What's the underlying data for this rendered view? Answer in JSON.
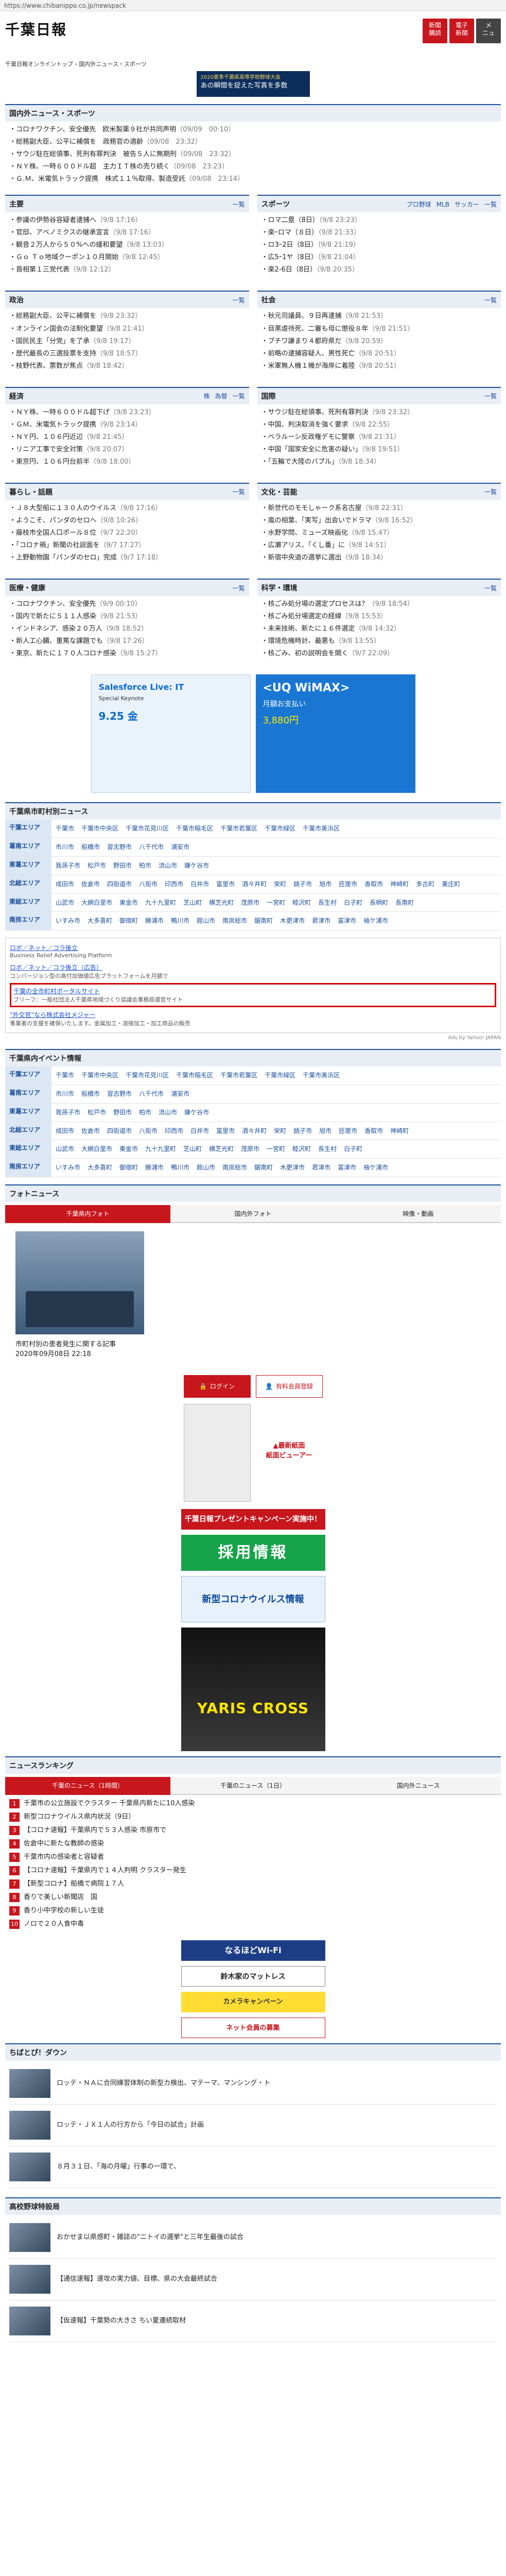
{
  "browser": {
    "url": "https://www.chibanippo.co.jp/newspack"
  },
  "header": {
    "logo": "千葉日報",
    "buttons": [
      "新聞\n購読",
      "電子\n新聞",
      "メ\nニュ"
    ],
    "breadcrumb": "千葉日報オンライントップ › 国内外ニュース・スポーツ"
  },
  "banner": {
    "line1": "2020夏季千葉県高等学校野球大会",
    "line2": "あの瞬間を捉えた写真を多数"
  },
  "domestic": {
    "title": "国内外ニュース・スポーツ",
    "items": [
      {
        "text": "・コロナワクチン、安全優先　欧米製薬９社が共同声明",
        "date": "（09/09　00:10）"
      },
      {
        "text": "・総務副大臣、公平に補償を　政務官の適齢",
        "date": "（09/08　23:32）"
      },
      {
        "text": "・サウジ駐在総領事、死刑有罪判決　被告５人に無期刑",
        "date": "（09/08　23:32）"
      },
      {
        "text": "・ＮＹ株、一時６００ドル超　主力ＩＴ株の売り続く",
        "date": "（09/08　23:23）"
      },
      {
        "text": "・Ｇ.Ｍ、米電気トラック提携　株式１１％取得、製造受託",
        "date": "（09/08　23:14）"
      }
    ]
  },
  "categories": [
    {
      "left": {
        "title": "主要",
        "more": "一覧",
        "items": [
          {
            "text": "・参議の伊勢谷容疑者逮捕へ",
            "date": "（9/8 17:16）"
          },
          {
            "text": "・官邸、アベノミクスの継承宣言",
            "date": "（9/8 17:16）"
          },
          {
            "text": "・観音２万人から５０%への緩和要望",
            "date": "（9/8 13:03）"
          },
          {
            "text": "・Ｇｏ Ｔｏ地域クーポン１０月開始",
            "date": "（9/8 12:45）"
          },
          {
            "text": "・首相第１三党代表",
            "date": "（9/8 12:12）"
          }
        ]
      },
      "right": {
        "title": "スポーツ",
        "tabs": [
          "プロ野球",
          "MLB",
          "サッカー"
        ],
        "more": "一覧",
        "items": [
          {
            "text": "・ロマ二塁（8日）",
            "date": "（9/8 23:23）"
          },
          {
            "text": "・楽ｰロマ（８日）",
            "date": "（9/8 21:33）"
          },
          {
            "text": "・ロ3ｰ2日（8日）",
            "date": "（9/8 21:19）"
          },
          {
            "text": "・広5ｰ1ヤ（8日）",
            "date": "（9/8 21:04）"
          },
          {
            "text": "・楽2-6日（8日）",
            "date": "（9/8 20:35）"
          }
        ]
      }
    },
    {
      "left": {
        "title": "政治",
        "more": "一覧",
        "items": [
          {
            "text": "・総務副大臣、公平に補償を",
            "date": "（9/8 23:32）"
          },
          {
            "text": "・オンライン国会の法制化要望",
            "date": "（9/8 21:41）"
          },
          {
            "text": "・国民民主「分党」を了承",
            "date": "（9/8 19:17）"
          },
          {
            "text": "・歴代最長の三選投票を支持",
            "date": "（9/8 18:57）"
          },
          {
            "text": "・枝野代表、票数が焦点",
            "date": "（9/8 18:42）"
          }
        ]
      },
      "right": {
        "title": "社会",
        "more": "一覧",
        "items": [
          {
            "text": "・秋元司議員、９日再逮捕",
            "date": "（9/8 21:53）"
          },
          {
            "text": "・目黒虐待死、二審も母に懲役８年",
            "date": "（9/8 21:51）"
          },
          {
            "text": "・ブチワ謙まり４都府県だ",
            "date": "（9/8 20:59）"
          },
          {
            "text": "・前略の逮捕容疑人、男性死亡",
            "date": "（9/8 20:51）"
          },
          {
            "text": "・米軍無人機１機が海岸に着陸",
            "date": "（9/8 20:51）"
          }
        ]
      }
    },
    {
      "left": {
        "title": "経済",
        "tabs": [
          "株",
          "為替"
        ],
        "more": "一覧",
        "items": [
          {
            "text": "・ＮＹ株、一時６００ドル超下げ",
            "date": "（9/8 23:23）"
          },
          {
            "text": "・ＧＭ、米電気トラック提携",
            "date": "（9/8 23:14）"
          },
          {
            "text": "・ＮＹ円、１０６円近辺",
            "date": "（9/8 21:45）"
          },
          {
            "text": "・リニア工事で安全対策",
            "date": "（9/8 20:07）"
          },
          {
            "text": "・東京円、１０６円台前半",
            "date": "（9/8 18:00）"
          }
        ]
      },
      "right": {
        "title": "国際",
        "more": "一覧",
        "items": [
          {
            "text": "・サウジ駐在総領事、死刑有罪判決",
            "date": "（9/8 23:32）"
          },
          {
            "text": "・中国、判決取消を強く要求",
            "date": "（9/8 22:55）"
          },
          {
            "text": "・ベラルーシ反政権デモに警察",
            "date": "（9/8 21:31）"
          },
          {
            "text": "・中国「国家安全に危害の疑い」",
            "date": "（9/8 19:51）"
          },
          {
            "text": "・「五輪で大陸のバブル」",
            "date": "（9/8 18:34）"
          }
        ]
      }
    },
    {
      "left": {
        "title": "暮らし・話題",
        "more": "一覧",
        "items": [
          {
            "text": "・Ｊ８大型船に１３０人のウイルス",
            "date": "（9/8 17:16）"
          },
          {
            "text": "・ようこそ、パンダのセロへ",
            "date": "（9/8 10:26）"
          },
          {
            "text": "・藤枝市全国人口ポール８位",
            "date": "（9/7 22:20）"
          },
          {
            "text": "・「コロナ禍」新聞の社説面を",
            "date": "（9/7 17:27）"
          },
          {
            "text": "・上野動物園「パンダのセロ」完成",
            "date": "（9/7 17:18）"
          }
        ]
      },
      "right": {
        "title": "文化・芸能",
        "more": "一覧",
        "items": [
          {
            "text": "・新世代のモモしゃーク系名古屋",
            "date": "（9/8 22:31）"
          },
          {
            "text": "・嵐の相葉、「実写」出会いでドラマ",
            "date": "（9/8 16:52）"
          },
          {
            "text": "・水野学問、ミューズ映画化",
            "date": "（9/8 15:47）"
          },
          {
            "text": "・広瀬アリス、「くし番」に",
            "date": "（9/8 14:51）"
          },
          {
            "text": "・新宿中央道の選挙に選出",
            "date": "（9/8 18:34）"
          }
        ]
      }
    },
    {
      "left": {
        "title": "医療・健康",
        "more": "一覧",
        "items": [
          {
            "text": "・コロナワクチン、安全優先",
            "date": "（9/9 00:10）"
          },
          {
            "text": "・国内で新たに５１１人感染",
            "date": "（9/8 21:53）"
          },
          {
            "text": "・インドネシア、感染２０万人",
            "date": "（9/8 18:52）"
          },
          {
            "text": "・新人工心臓、重篤な課題でも",
            "date": "（9/8 17:26）"
          },
          {
            "text": "・東京、新たに１７０人コロナ感染",
            "date": "（9/8 15:27）"
          }
        ]
      },
      "right": {
        "title": "科学・環境",
        "more": "一覧",
        "items": [
          {
            "text": "・核ごみ処分場の選定プロセスは？",
            "date": "（9/8 18:54）"
          },
          {
            "text": "・核ごみ処分場選定の経緯",
            "date": "（9/8 15:53）"
          },
          {
            "text": "・未来技術、新たに１６件選定",
            "date": "（9/8 14:32）"
          },
          {
            "text": "・環境危機時計、最悪も",
            "date": "（9/8 13:55）"
          },
          {
            "text": "・核ごみ、初の説明会を開く",
            "date": "（9/7 22:09）"
          }
        ]
      }
    }
  ],
  "ads": {
    "salesforce": {
      "line1": "Salesforce Live: IT",
      "line2": "Special Keynote",
      "line3": "9.25 金"
    },
    "wimax": {
      "line1": "<UQ WiMAX>",
      "line2": "月額お支払い",
      "line3": "3,880円"
    }
  },
  "city_news": {
    "title": "千葉県市町村別ニュース",
    "rows": [
      {
        "area": "千葉エリア",
        "towns": [
          "千葉市",
          "千葉市中央区",
          "千葉市花見川区",
          "千葉市稲毛区",
          "千葉市若葉区",
          "千葉市緑区",
          "千葉市美浜区"
        ]
      },
      {
        "area": "葛南エリア",
        "towns": [
          "市川市",
          "船橋市",
          "習志野市",
          "八千代市",
          "浦安市"
        ]
      },
      {
        "area": "東葛エリア",
        "towns": [
          "我孫子市",
          "松戸市",
          "野田市",
          "柏市",
          "流山市",
          "鎌ケ谷市"
        ]
      },
      {
        "area": "北総エリア",
        "towns": [
          "成田市",
          "佐倉市",
          "四街道市",
          "八街市",
          "印西市",
          "白井市",
          "富里市",
          "酒々井町",
          "栄町",
          "銚子市",
          "旭市",
          "匝瑳市",
          "香取市",
          "神崎町",
          "多古町",
          "東庄町"
        ]
      },
      {
        "area": "東総エリア",
        "towns": [
          "山武市",
          "大網白里市",
          "東金市",
          "九十九里町",
          "芝山町",
          "横芝光町",
          "茂原市",
          "一宮町",
          "睦沢町",
          "長生村",
          "白子町",
          "長柄町",
          "長南町"
        ]
      },
      {
        "area": "南房エリア",
        "towns": [
          "いすみ市",
          "大多喜町",
          "御宿町",
          "勝浦市",
          "鴨川市",
          "館山市",
          "南房総市",
          "鋸南町",
          "木更津市",
          "君津市",
          "富津市",
          "袖ケ浦市"
        ]
      }
    ]
  },
  "sponsor": {
    "items": [
      {
        "title": "ロボ／ネット／コラ後立",
        "desc": "Business Relief Advertising Platform"
      },
      {
        "title": "ロボ／ネット／コラ後立（広告）",
        "desc": "コンバージョン型の高付加価値広告プラットフォームを月額で"
      },
      {
        "title": "千葉の全市町村ポータルサイト",
        "desc": "ブリーフ：一般社団法人千葉県地域づくり協議会事務局運営サイト"
      },
      {
        "title": "\"外交官\"なら株式会社メジャー",
        "desc": "事業者の支援を確保いたします。金属加工・溶接加工・加工商品の販売"
      }
    ],
    "ads_by": "Ads by Yahoo! JAPAN"
  },
  "events": {
    "title": "千葉県内イベント情報",
    "rows": [
      {
        "area": "千葉エリア",
        "towns": [
          "千葉市",
          "千葉市中央区",
          "千葉市花見川区",
          "千葉市稲毛区",
          "千葉市若葉区",
          "千葉市緑区",
          "千葉市美浜区"
        ]
      },
      {
        "area": "葛南エリア",
        "towns": [
          "市川市",
          "船橋市",
          "習志野市",
          "八千代市",
          "浦安市"
        ]
      },
      {
        "area": "東葛エリア",
        "towns": [
          "我孫子市",
          "松戸市",
          "野田市",
          "柏市",
          "流山市",
          "鎌ケ谷市"
        ]
      },
      {
        "area": "北総エリア",
        "towns": [
          "成田市",
          "佐倉市",
          "四街道市",
          "八街市",
          "印西市",
          "白井市",
          "富里市",
          "酒々井町",
          "栄町",
          "銚子市",
          "旭市",
          "匝瑳市",
          "香取市",
          "神崎町"
        ]
      },
      {
        "area": "東総エリア",
        "towns": [
          "山武市",
          "大網白里市",
          "東金市",
          "九十九里町",
          "芝山町",
          "横芝光町",
          "茂原市",
          "一宮町",
          "睦沢町",
          "長生村",
          "白子町"
        ]
      },
      {
        "area": "南房エリア",
        "towns": [
          "いすみ市",
          "大多喜町",
          "御宿町",
          "勝浦市",
          "鴨川市",
          "館山市",
          "南房総市",
          "鋸南町",
          "木更津市",
          "君津市",
          "富津市",
          "袖ケ浦市"
        ]
      }
    ]
  },
  "photo": {
    "title": "フォトニュース",
    "tabs": [
      "千葉県内フォト",
      "国内外フォト",
      "映像・動画"
    ],
    "caption": "市町村別の患者発生に関する記事",
    "date": "2020年09月08日 22:18"
  },
  "side": {
    "login": "ログイン",
    "register": "有料会員登録",
    "viewer": [
      "▲最新紙面",
      "紙面ビューアー"
    ],
    "campaign": "千葉日報プレゼントキャンペーン実施中！",
    "job": "採用情報",
    "covid": "新型コロナウイルス情報",
    "car_ad": "YARIS CROSS",
    "wifi": "なるほどWi-Fi",
    "mat": "鈴木家のマットレス",
    "camera": "カメラキャンペーン",
    "club": "ネット会員の募集"
  },
  "ranking": {
    "title": "ニュースランキング",
    "tabs": [
      "千葉のニュース（1時間）",
      "千葉のニュース（1日）",
      "国内外ニュース"
    ],
    "items": [
      "千葉市の公立施設でクラスター 千葉県内新たに10人感染",
      "新型コロナウイルス県内状況（9日）",
      "【コロナ速報】千葉県内で５３人感染 市原市で",
      "佐倉中に新たな教師の感染",
      "千葉市内の感染者と容疑者",
      "【コロナ速報】千葉県内で１４人判明 クラスター発生",
      "【新型コロナ】船橋で病院１７人",
      "香りで美しい新聞店　国",
      "香り小中学校の新しい生徒",
      "ノロで２０人食中毒"
    ]
  },
  "chibadown": {
    "title": "ちばとぴ！ダウン",
    "items": [
      "ロッテ・ＮＡに合同練習体制の新型カ検出、マテーマ、マンシング・ト",
      "ロッテ・ＪＸ１人の行方から「今日の試合」計画",
      "８月３１日、「海の月曜」行事の一環で、"
    ]
  },
  "school": {
    "title": "高校野球特設局",
    "items": [
      "おかせま以県感町・雑誌の\"ニトイの選挙\"と三年生最後の試合",
      "【通信速報】速攻の実力値、目標、県の大会最終試合",
      "【仮速報】千葉勢の大きさ ちい夏連続取材"
    ]
  },
  "colors": {
    "brand_red": "#c8161d",
    "accent_blue": "#1c4f9c"
  }
}
